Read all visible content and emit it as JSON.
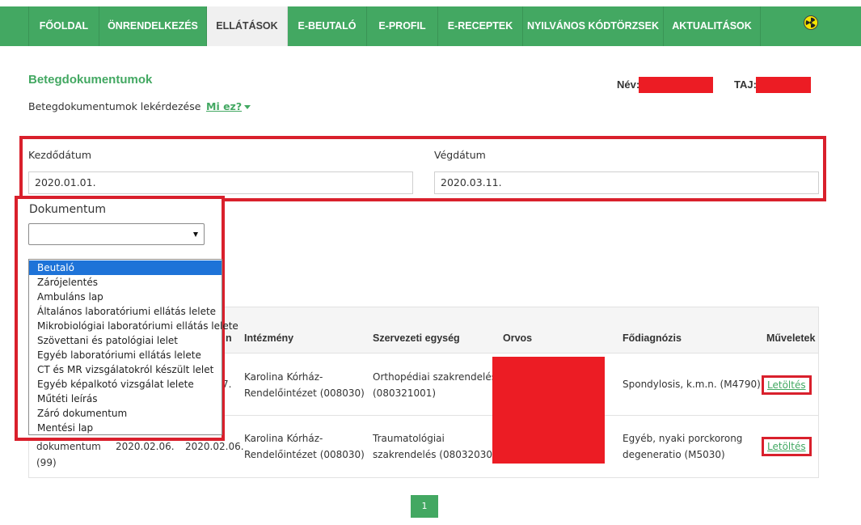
{
  "nav": {
    "items": [
      {
        "label": "FŐOLDAL",
        "active": false
      },
      {
        "label": "ÖNRENDELKEZÉS",
        "active": false
      },
      {
        "label": "ELLÁTÁSOK",
        "active": true
      },
      {
        "label": "E-BEUTALÓ",
        "active": false
      },
      {
        "label": "E-PROFIL",
        "active": false
      },
      {
        "label": "E-RECEPTEK",
        "active": false
      },
      {
        "label": "NYILVÁNOS KÓDTÖRZSEK",
        "active": false
      },
      {
        "label": "AKTUALITÁSOK",
        "active": false
      }
    ],
    "icon": "accessibility-icon",
    "color": "#43a862"
  },
  "header": {
    "title": "Betegdokumentumok",
    "subtitle": "Betegdokumentumok lekérdezése",
    "help_link": "Mi ez?",
    "name_label": "Név:",
    "taj_label": "TAJ:"
  },
  "filters": {
    "start_label": "Kezdődátum",
    "start_value": "2020.01.01.",
    "end_label": "Végdátum",
    "end_value": "2020.03.11.",
    "document_label": "Dokumentum",
    "document_value": ""
  },
  "dropdown": {
    "options": [
      "Beutaló",
      "Zárójelentés",
      "Ambuláns lap",
      "Általános laboratóriumi ellátás lelete",
      "Mikrobiológiai laboratóriumi ellátás lelete",
      "Szövettani és patológiai lelet",
      "Egyéb laboratóriumi ellátás lelete",
      "CT és MR vizsgálatokról készült lelet",
      "Egyéb képalkotó vizsgálat lelete",
      "Műtéti leírás",
      "Záró dokumentum",
      "Mentési lap"
    ],
    "selected": "Beutaló"
  },
  "table": {
    "headers": {
      "col3_fragment": "n",
      "institution": "Intézmény",
      "unit": "Szervezeti egység",
      "doctor": "Orvos",
      "diagnosis": "Fődiagnózis",
      "actions": "Műveletek"
    },
    "rows": [
      {
        "date_fragment": "7.",
        "institution_line1": "Karolina Kórház-",
        "institution_line2": "Rendelőintézet (008030)",
        "unit_line1": "Orthopédiai szakrendelés",
        "unit_line2": "(080321001)",
        "diagnosis_line1": "Spondylosis, k.m.n. (M4790)",
        "diagnosis_line2": "",
        "action": "Letöltés"
      },
      {
        "type_line1": "dokumentum",
        "type_line2": "(99)",
        "date1": "2020.02.06.",
        "date2": "2020.02.06.",
        "institution_line1": "Karolina Kórház-",
        "institution_line2": "Rendelőintézet (008030)",
        "unit_line1": "Traumatológiai",
        "unit_line2": "szakrendelés (080320301)",
        "diagnosis_line1": "Egyéb, nyaki porckorong",
        "diagnosis_line2": "degeneratio (M5030)",
        "action": "Letöltés"
      }
    ]
  },
  "pagination": {
    "current": "1"
  },
  "colors": {
    "accent": "#43a862",
    "highlight": "#d9202c",
    "redaction": "#ec1c24",
    "selected_option": "#1e73d8"
  }
}
